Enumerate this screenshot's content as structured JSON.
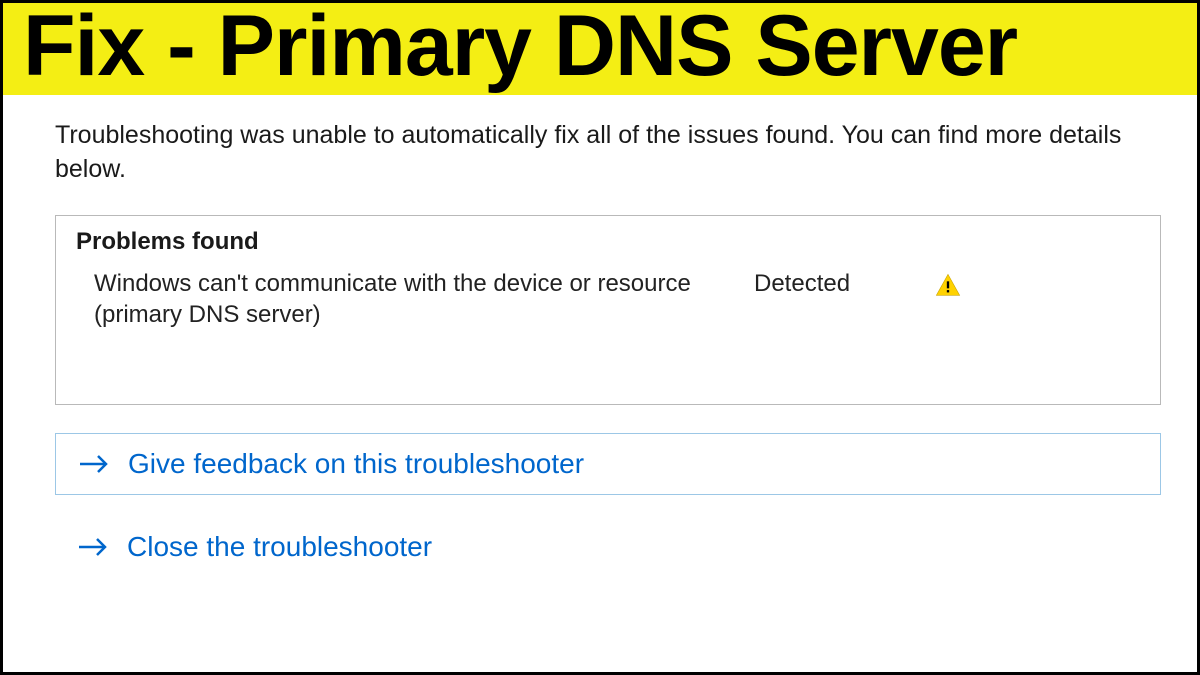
{
  "banner": {
    "title": "Fix - Primary DNS Server"
  },
  "summary_text": "Troubleshooting was unable to automatically fix all of the issues found. You can find more details below.",
  "problems": {
    "heading": "Problems found",
    "items": [
      {
        "text": "Windows can't communicate with the device or resource (primary DNS server)",
        "status": "Detected"
      }
    ]
  },
  "actions": {
    "feedback": "Give feedback on this troubleshooter",
    "close": "Close the troubleshooter"
  }
}
